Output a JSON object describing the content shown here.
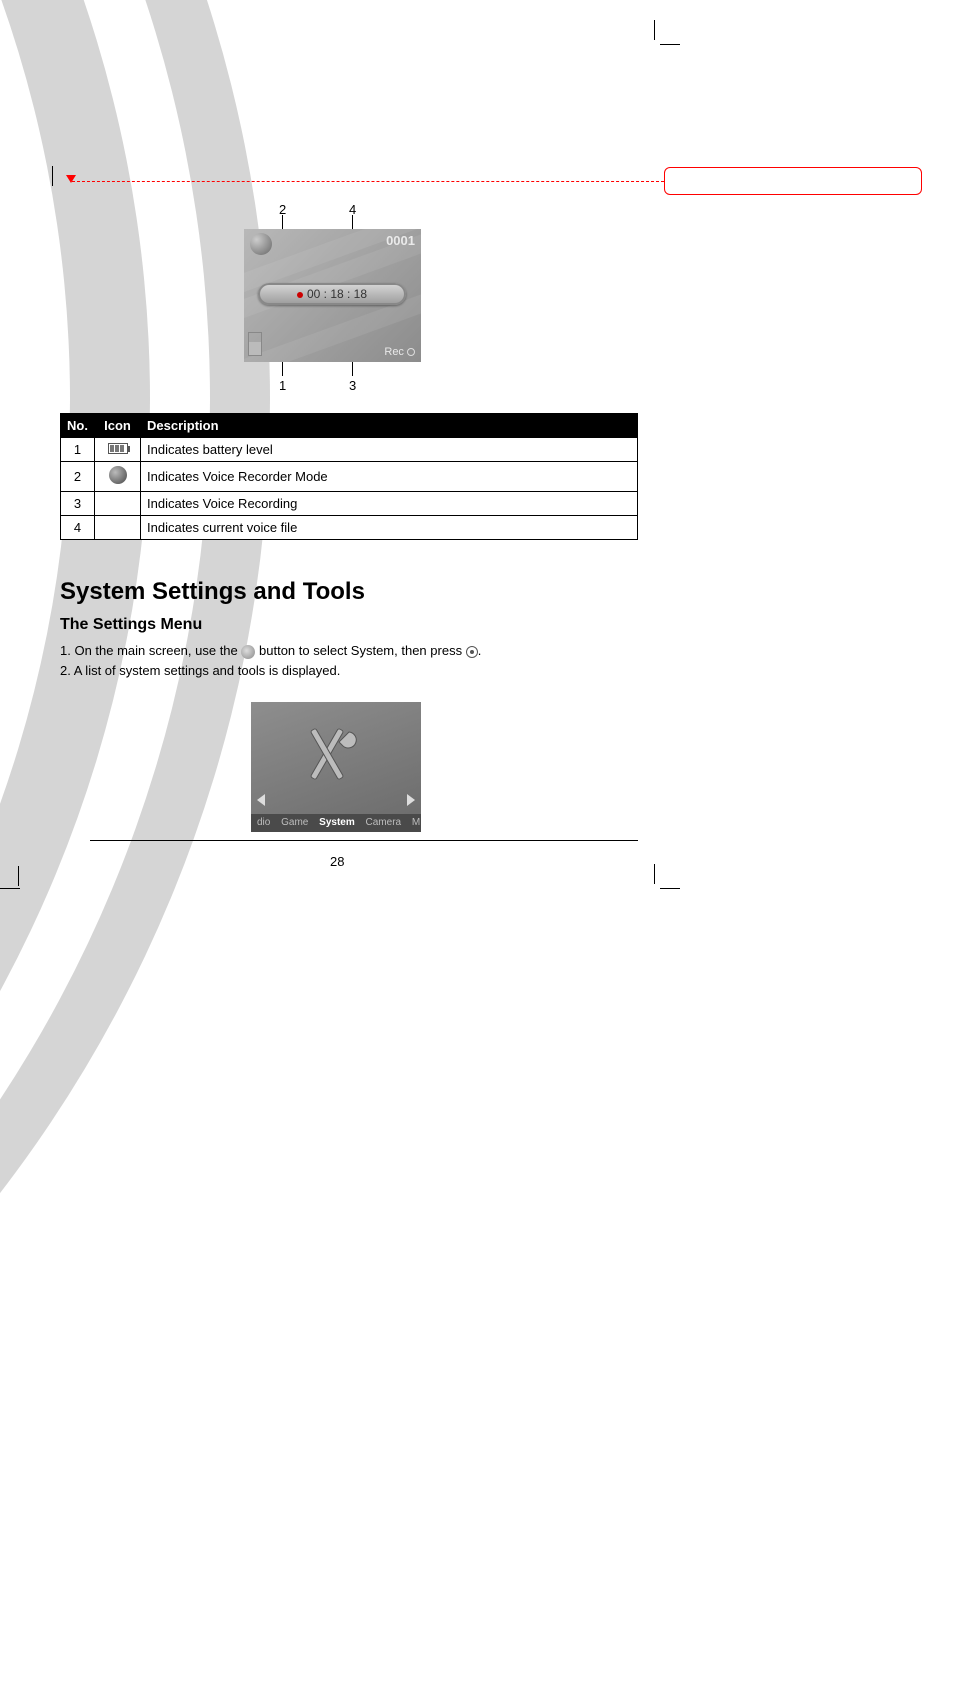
{
  "crop_marks": true,
  "screen1": {
    "count": "0001",
    "time": "00 : 18 : 18",
    "rec_label": "Rec"
  },
  "screen1_labels": {
    "top_left": "2",
    "top_right": "4",
    "bottom_left": "1",
    "bottom_right": "3"
  },
  "table": {
    "headers": [
      "No.",
      "Icon",
      "Description"
    ],
    "rows": [
      {
        "num": "1",
        "icon": "battery",
        "desc": "Indicates battery level"
      },
      {
        "num": "2",
        "icon": "mic",
        "desc": "Indicates Voice Recorder Mode"
      },
      {
        "num": "3",
        "icon": "",
        "desc": "Indicates Voice Recording"
      },
      {
        "num": "4",
        "icon": "",
        "desc": "Indicates current voice file"
      }
    ]
  },
  "system": {
    "heading": "System Settings and Tools",
    "subheading": "The Settings Menu",
    "line_prefix": "1.    On the main screen, use the ",
    "line_mid": " button to select  System, then press",
    "line2": "2.    A list of system settings and tools is displayed."
  },
  "screen2_menu": {
    "items": [
      "dio",
      "Game",
      "System",
      "Camera",
      "M"
    ],
    "selected_index": 2
  },
  "page_number": "28"
}
